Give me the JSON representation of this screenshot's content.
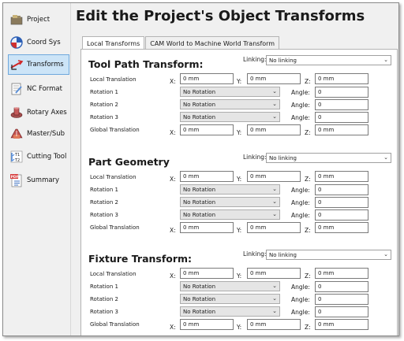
{
  "title": "Edit the Project's Object Transforms",
  "nav": [
    {
      "label": "Project",
      "icon": "project-icon",
      "active": false
    },
    {
      "label": "Coord Sys",
      "icon": "coord-sys-icon",
      "active": false
    },
    {
      "label": "Transforms",
      "icon": "transforms-icon",
      "active": true
    },
    {
      "label": "NC Format",
      "icon": "nc-format-icon",
      "active": false
    },
    {
      "label": "Rotary Axes",
      "icon": "rotary-axes-icon",
      "active": false
    },
    {
      "label": "Master/Sub",
      "icon": "master-sub-icon",
      "active": false
    },
    {
      "label": "Cutting Tool",
      "icon": "cutting-tool-icon",
      "active": false
    },
    {
      "label": "Summary",
      "icon": "summary-icon",
      "active": false
    }
  ],
  "tabs": [
    {
      "label": "Local Transforms",
      "active": true
    },
    {
      "label": "CAM World to Machine World Transform",
      "active": false
    }
  ],
  "labels": {
    "linking": "Linking:",
    "local_translation": "Local Translation",
    "rotation_1": "Rotation 1",
    "rotation_2": "Rotation 2",
    "rotation_3": "Rotation 3",
    "global_translation": "Global Translation",
    "angle": "Angle:",
    "x": "X:",
    "y": "Y:",
    "z": "Z:"
  },
  "sections": [
    {
      "title": "Tool Path Transform:",
      "linking": "No linking",
      "local": {
        "x": "0 mm",
        "y": "0 mm",
        "z": "0 mm"
      },
      "rotations": [
        {
          "value": "No Rotation",
          "angle": "0"
        },
        {
          "value": "No Rotation",
          "angle": "0"
        },
        {
          "value": "No Rotation",
          "angle": "0"
        }
      ],
      "global": {
        "x": "0 mm",
        "y": "0 mm",
        "z": "0 mm"
      }
    },
    {
      "title": "Part Geometry",
      "linking": "No linking",
      "local": {
        "x": "0 mm",
        "y": "0 mm",
        "z": "0 mm"
      },
      "rotations": [
        {
          "value": "No Rotation",
          "angle": "0"
        },
        {
          "value": "No Rotation",
          "angle": "0"
        },
        {
          "value": "No Rotation",
          "angle": "0"
        }
      ],
      "global": {
        "x": "0 mm",
        "y": "0 mm",
        "z": "0 mm"
      }
    },
    {
      "title": "Fixture Transform:",
      "linking": "No linking",
      "local": {
        "x": "0 mm",
        "y": "0 mm",
        "z": "0 mm"
      },
      "rotations": [
        {
          "value": "No Rotation",
          "angle": "0"
        },
        {
          "value": "No Rotation",
          "angle": "0"
        },
        {
          "value": "No Rotation",
          "angle": "0"
        }
      ],
      "global": {
        "x": "0 mm",
        "y": "0 mm",
        "z": "0 mm"
      }
    }
  ]
}
